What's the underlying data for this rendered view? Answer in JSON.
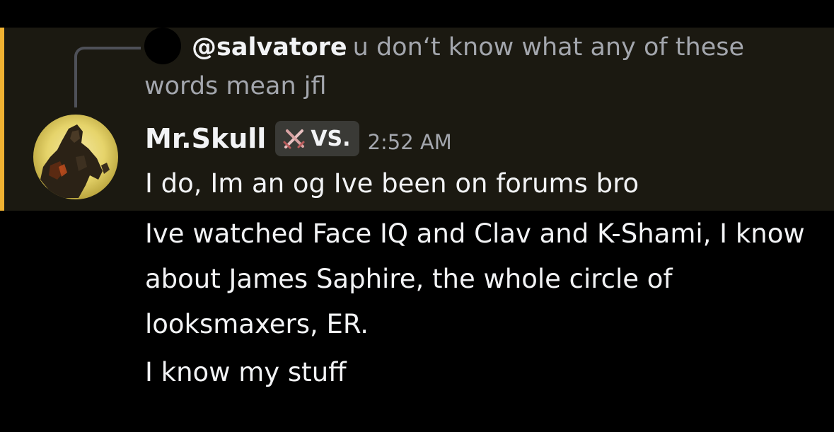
{
  "colors": {
    "mention_bar": "#f0b232",
    "mention_bg": "#1b1911",
    "background": "#000000"
  },
  "reply": {
    "author": "@salvatore",
    "text": "u don‘t know what any of these words mean jfl"
  },
  "message": {
    "author": "Mr.Skull",
    "tag": {
      "icon": "crossed-swords-icon",
      "label": "VS."
    },
    "timestamp": "2:52 AM",
    "lines": [
      "I do, Im an og Ive been on forums bro",
      "Ive watched Face IQ and Clav and K-Shami, I know about James Saphire, the whole circle of looksmaxers, ER.",
      "I know my stuff"
    ]
  }
}
